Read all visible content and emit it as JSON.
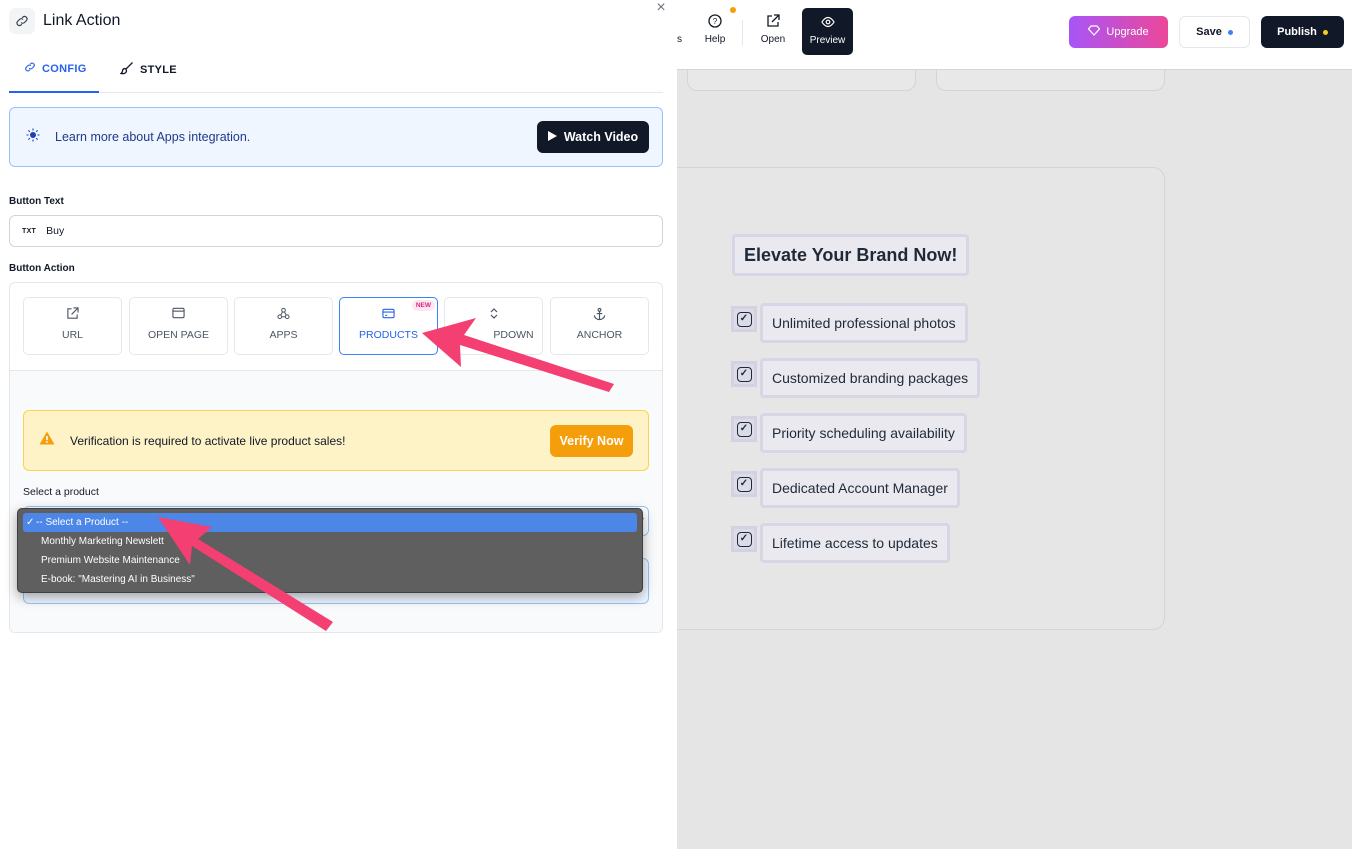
{
  "panel": {
    "title": "Link Action",
    "close_icon": "×",
    "tabs": [
      {
        "label": "CONFIG",
        "icon": "link-icon"
      },
      {
        "label": "STYLE",
        "icon": "brush-icon"
      }
    ],
    "info_banner": {
      "text": "Learn more about Apps integration.",
      "button": "Watch Video"
    },
    "button_text": {
      "label": "Button Text",
      "prefix": "TXT",
      "value": "Buy"
    },
    "button_action": {
      "label": "Button Action",
      "options": [
        {
          "label": "URL",
          "icon": "external-link-icon"
        },
        {
          "label": "OPEN PAGE",
          "icon": "window-icon"
        },
        {
          "label": "APPS",
          "icon": "webhook-icon"
        },
        {
          "label": "PRODUCTS",
          "icon": "card-icon",
          "badge": "NEW",
          "selected": true
        },
        {
          "label": "DROPDOWN",
          "visible_label": "PDOWN",
          "icon": "chevron-updown-icon"
        },
        {
          "label": "ANCHOR",
          "icon": "anchor-icon"
        }
      ]
    },
    "warning": {
      "text": "Verification is required to activate live product sales!",
      "button": "Verify Now"
    },
    "select_product": {
      "label": "Select a product",
      "options": [
        "-- Select a Product --",
        "Monthly Marketing Newslett",
        "Premium Website Maintenance",
        "E-book: \"Mastering AI in Business\""
      ],
      "selected_index": 0
    }
  },
  "topbar": {
    "cut_label": "s",
    "help": "Help",
    "open": "Open",
    "preview": "Preview",
    "upgrade": "Upgrade",
    "save": "Save",
    "publish": "Publish"
  },
  "canvas": {
    "headline": "Elevate Your Brand Now!",
    "features": [
      "Unlimited professional photos",
      "Customized branding packages",
      "Priority scheduling availability",
      "Dedicated Account Manager",
      "Lifetime access to updates"
    ]
  },
  "colors": {
    "accent": "#2563eb",
    "arrow": "#f43f72",
    "warning": "#f59e0b",
    "dark": "#111827"
  }
}
